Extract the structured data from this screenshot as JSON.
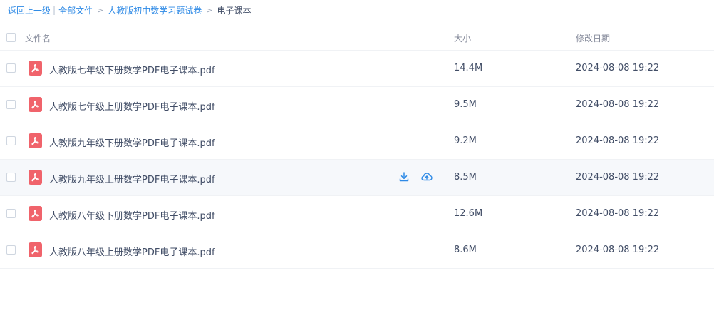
{
  "breadcrumb": {
    "back": "返回上一级",
    "pipe": "|",
    "all_files": "全部文件",
    "sep1": ">",
    "folder": "人教版初中数学习题试卷",
    "sep2": ">",
    "current": "电子课本"
  },
  "table": {
    "headers": {
      "name": "文件名",
      "size": "大小",
      "modified": "修改日期"
    },
    "rows": [
      {
        "name": "人教版七年级下册数学PDF电子课本.pdf",
        "size": "14.4M",
        "modified": "2024-08-08 19:22"
      },
      {
        "name": "人教版七年级上册数学PDF电子课本.pdf",
        "size": "9.5M",
        "modified": "2024-08-08 19:22"
      },
      {
        "name": "人教版九年级下册数学PDF电子课本.pdf",
        "size": "9.2M",
        "modified": "2024-08-08 19:22"
      },
      {
        "name": "人教版九年级上册数学PDF电子课本.pdf",
        "size": "8.5M",
        "modified": "2024-08-08 19:22"
      },
      {
        "name": "人教版八年级下册数学PDF电子课本.pdf",
        "size": "12.6M",
        "modified": "2024-08-08 19:22"
      },
      {
        "name": "人教版八年级上册数学PDF电子课本.pdf",
        "size": "8.6M",
        "modified": "2024-08-08 19:22"
      }
    ]
  },
  "icons": {
    "file": "pdf-file-icon",
    "download": "download-icon",
    "cloud": "cloud-upload-icon"
  },
  "colors": {
    "link": "#2e8ae6",
    "pdf_icon": "#f0636b",
    "hover_row": "#f6f8fb",
    "text": "#424e67",
    "header_text": "#878c9c"
  }
}
